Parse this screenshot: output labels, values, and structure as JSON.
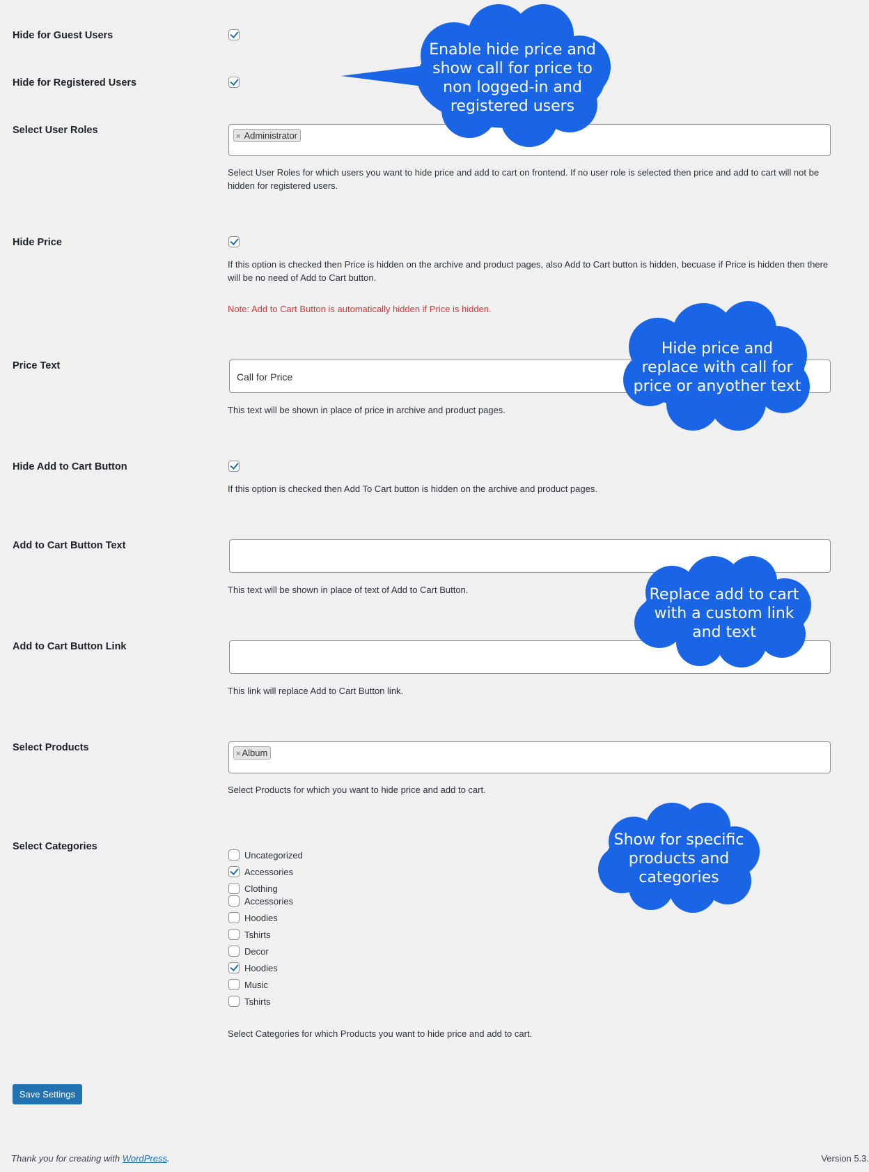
{
  "settings": {
    "hide_guest": {
      "label": "Hide for Guest Users",
      "checked": true
    },
    "hide_registered": {
      "label": "Hide for Registered Users",
      "checked": true
    },
    "user_roles": {
      "label": "Select User Roles",
      "tags": [
        "Administrator"
      ],
      "description": "Select User Roles for which users you want to hide price and add to cart on frontend. If no user role is selected then price and add to cart will not be hidden for registered users."
    },
    "hide_price": {
      "label": "Hide Price",
      "checked": true,
      "description": "If this option is checked then Price is hidden on the archive and product pages, also Add to Cart button is hidden, becuase if Price is hidden then there will be no need of Add to Cart button.",
      "note": "Note: Add to Cart Button is automatically hidden if Price is hidden."
    },
    "price_text": {
      "label": "Price Text",
      "value": "Call for Price",
      "description": "This text will be shown in place of price in archive and product pages."
    },
    "hide_add_to_cart": {
      "label": "Hide Add to Cart Button",
      "checked": true,
      "description": "If this option is checked then Add To Cart button is hidden on the archive and product pages."
    },
    "add_to_cart_text": {
      "label": "Add to Cart Button Text",
      "value": "",
      "description": "This text will be shown in place of text of Add to Cart Button."
    },
    "add_to_cart_link": {
      "label": "Add to Cart Button Link",
      "value": "",
      "description": "This link will replace Add to Cart Button link."
    },
    "products": {
      "label": "Select Products",
      "tags": [
        "Album"
      ],
      "description": "Select Products for which you want to hide price and add to cart."
    },
    "categories": {
      "label": "Select Categories",
      "items": [
        {
          "name": "Uncategorized",
          "checked": false
        },
        {
          "name": "Accessories",
          "checked": true
        },
        {
          "name": "Clothing",
          "checked": false
        },
        {
          "name": "Accessories",
          "checked": false
        },
        {
          "name": "Hoodies",
          "checked": false
        },
        {
          "name": "Tshirts",
          "checked": false
        },
        {
          "name": "Decor",
          "checked": false
        },
        {
          "name": "Hoodies",
          "checked": true
        },
        {
          "name": "Music",
          "checked": false
        },
        {
          "name": "Tshirts",
          "checked": false
        }
      ],
      "description": "Select Categories for which Products you want to hide price and add to cart."
    }
  },
  "save_button": "Save Settings",
  "footer": {
    "thanks_prefix": "Thank you for creating with ",
    "link": "WordPress",
    "thanks_suffix": ".",
    "version": "Version 5.3."
  },
  "callouts": {
    "color": "#1a64e6",
    "bubble1": [
      "Enable hide price and",
      "show call for price to",
      "non logged-in and",
      "registered users"
    ],
    "bubble2": [
      "Hide price and",
      "replace with call for",
      "price or anyother text"
    ],
    "bubble3": [
      "Replace add to cart",
      "with a custom link",
      "and text"
    ],
    "bubble4": [
      "Show for specific",
      "products and",
      "categories"
    ]
  }
}
